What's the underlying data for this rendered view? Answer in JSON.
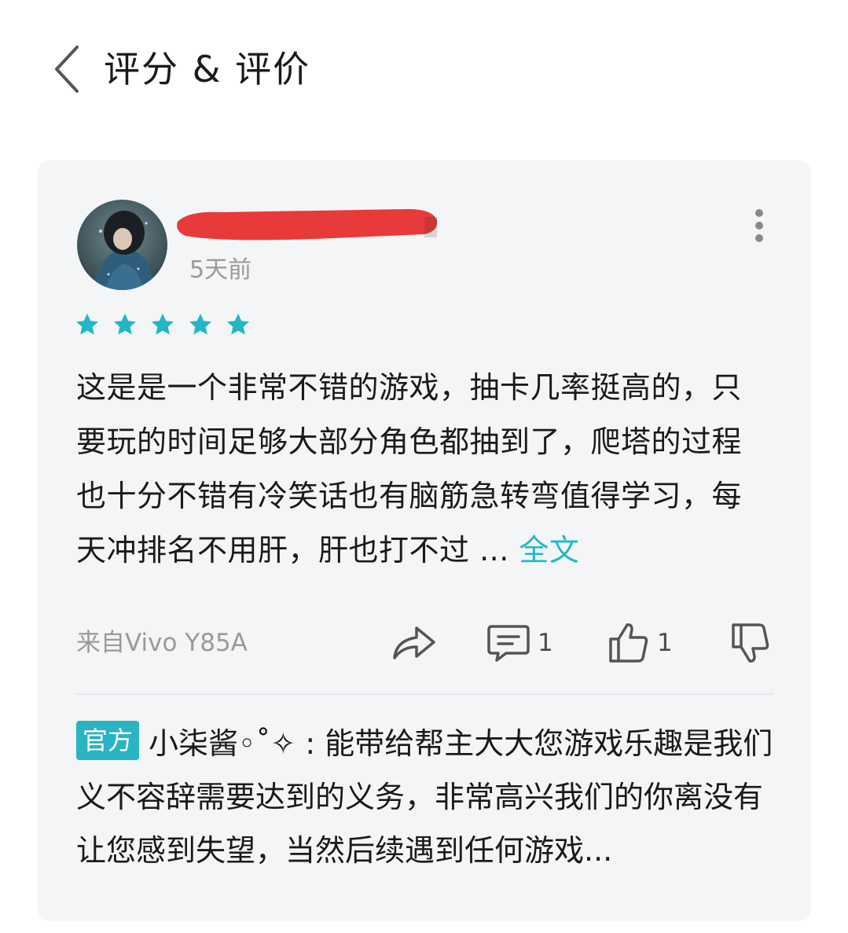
{
  "header": {
    "title": "评分 & 评价",
    "back_icon": "chevron-left-icon"
  },
  "review": {
    "timestamp": "5天前",
    "rating": 5,
    "rating_max": 5,
    "text": "这是是一个非常不错的游戏，抽卡几率挺高的，只要玩的时间足够大部分角色都抽到了，爬塔的过程也十分不错有冷笑话也有脑筋急转弯值得学习，每天冲排名不用肝，肝也打不过 ...",
    "full_text_label": "全文",
    "device": "来自Vivo Y85A",
    "actions": {
      "share_icon": "share-icon",
      "comment_icon": "comment-icon",
      "comment_count": "1",
      "like_icon": "thumbs-up-icon",
      "like_count": "1",
      "dislike_icon": "thumbs-down-icon"
    }
  },
  "official_reply": {
    "badge": "官方",
    "text": "小柒酱◦˚✧ : 能带给帮主大大您游戏乐趣是我们义不容辞需要达到的义务，非常高兴我们的你离没有让您感到失望，当然后续遇到任何游戏..."
  },
  "colors": {
    "accent": "#1fb8c8",
    "star": "#22b6c6",
    "badge_bg": "#2ab3c0",
    "card_bg": "#f4f5f7",
    "redaction": "#e83a3a"
  }
}
